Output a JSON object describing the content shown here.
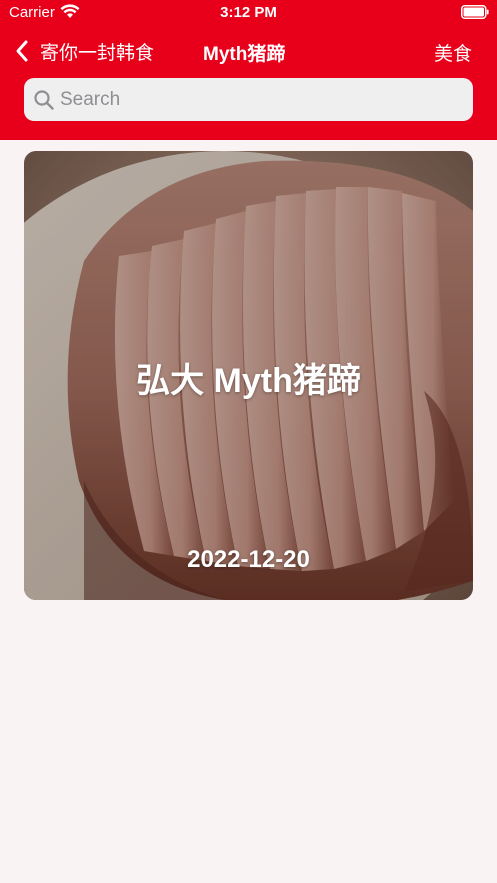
{
  "status_bar": {
    "carrier": "Carrier",
    "time": "3:12 PM",
    "wifi_icon": "wifi-icon",
    "battery_icon": "battery-icon"
  },
  "nav": {
    "back_label": "寄你一封韩食",
    "back_icon": "chevron-left-icon",
    "title": "Myth猪蹄",
    "right_label": "美食"
  },
  "search": {
    "placeholder": "Search",
    "value": "",
    "icon": "search-icon"
  },
  "cards": [
    {
      "title": "弘大 Myth猪蹄",
      "date": "2022-12-20",
      "image": "sliced-roast-pork-hock-photo"
    }
  ],
  "colors": {
    "header_red": "#e8001a",
    "page_background": "#f9f4f3",
    "search_background": "#efefef"
  }
}
